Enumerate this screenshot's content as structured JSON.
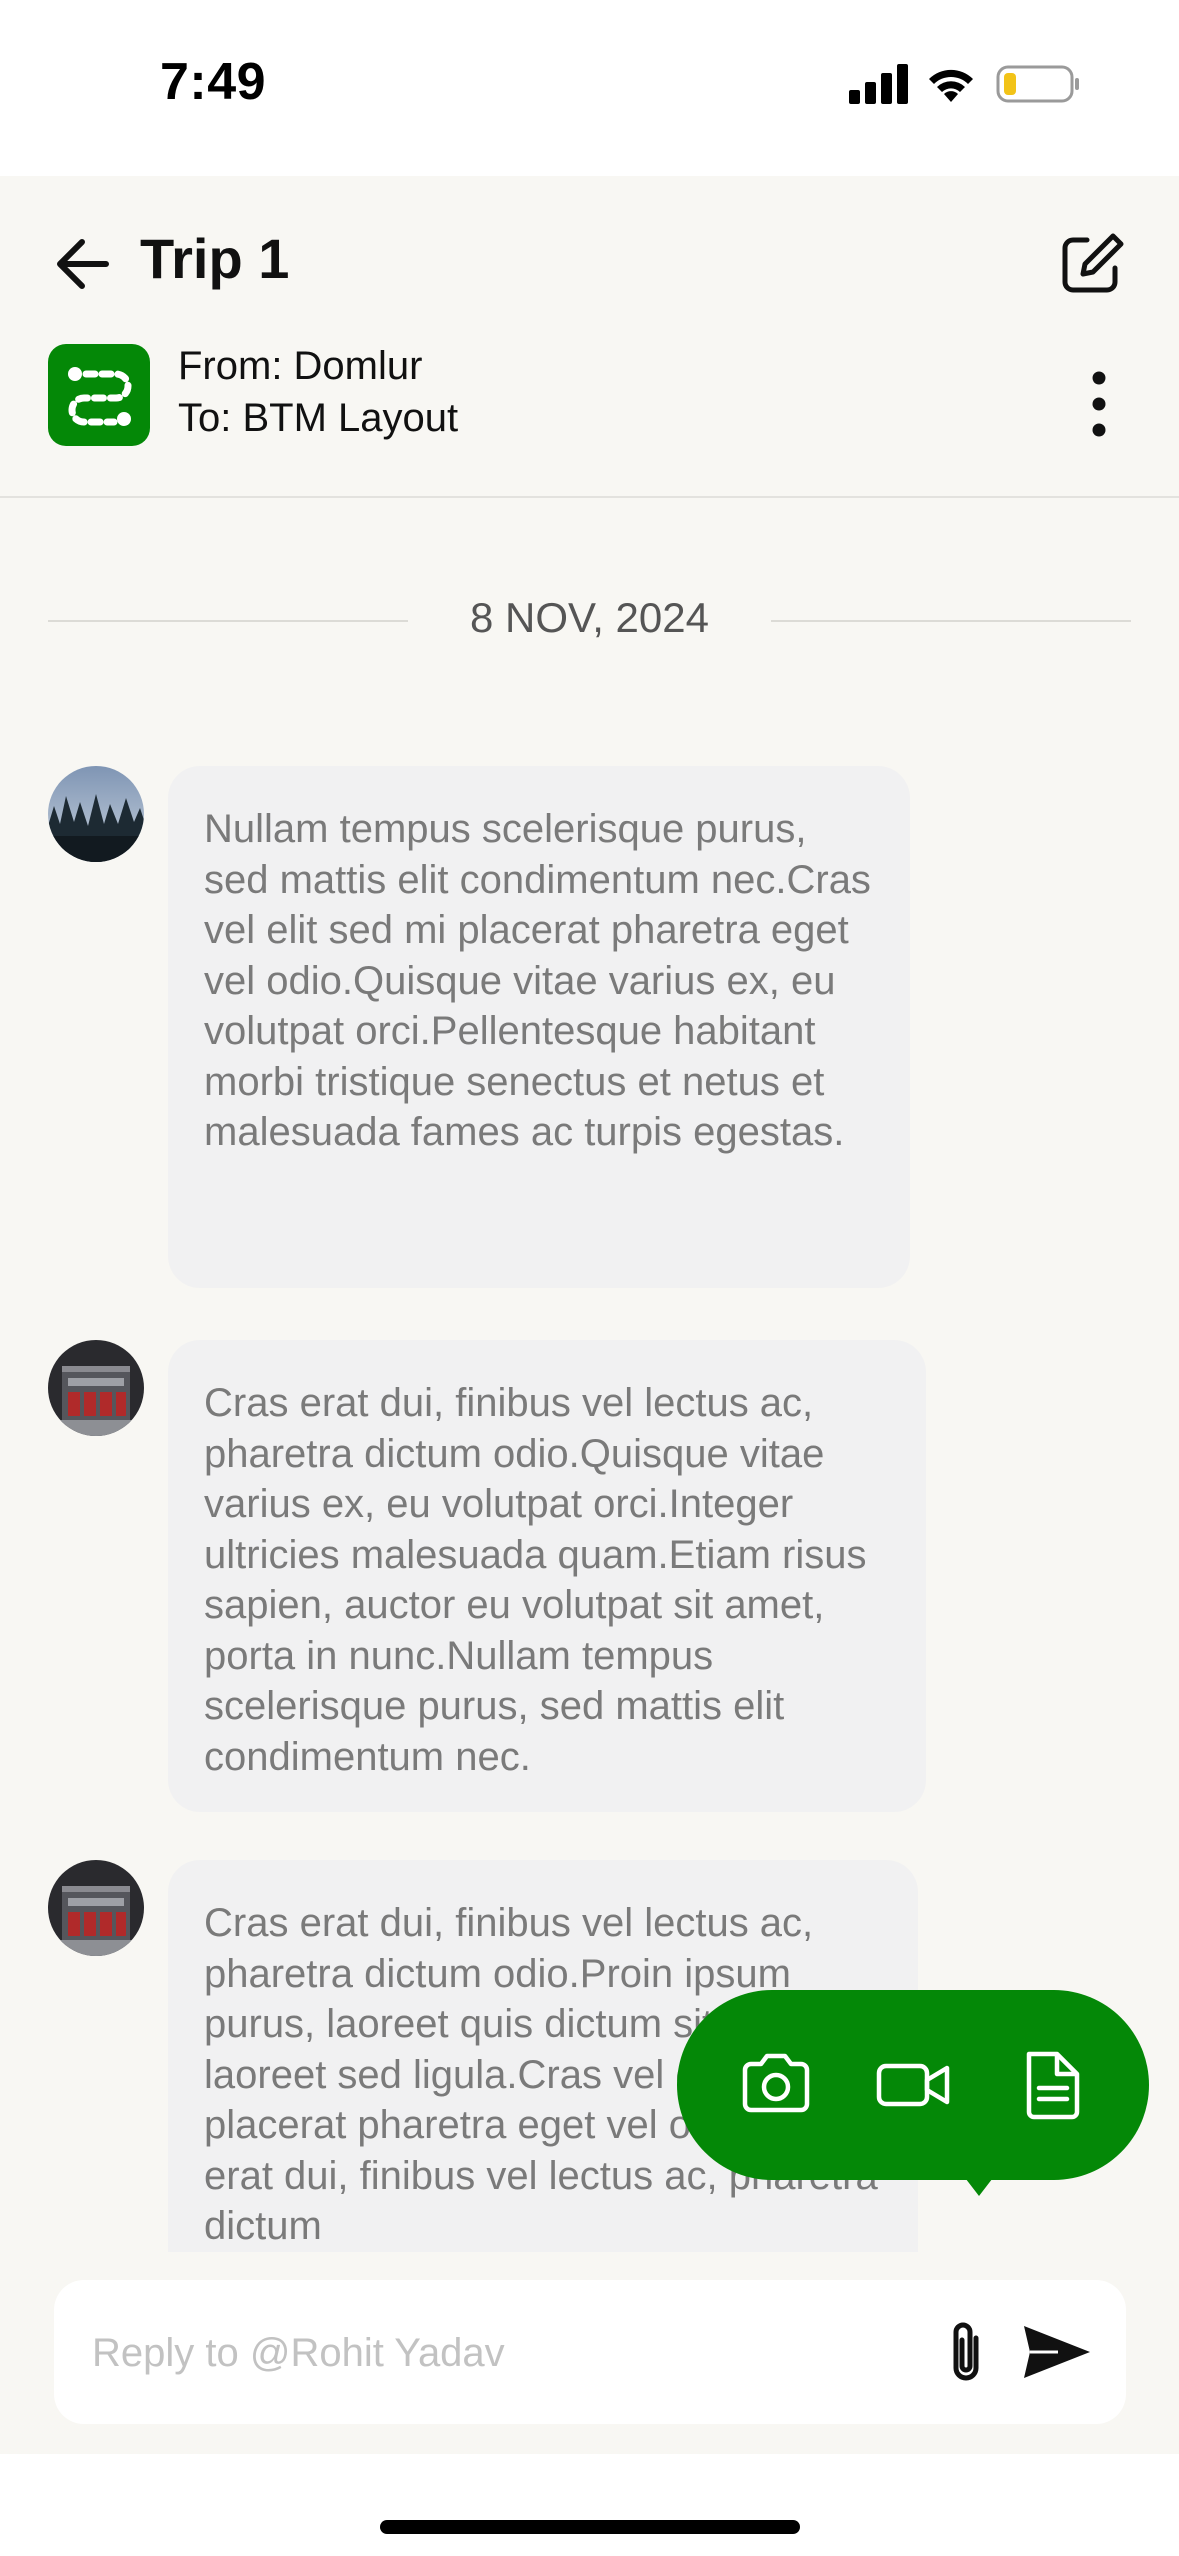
{
  "status_bar": {
    "time": "7:49",
    "icons": [
      "cellular-signal-icon",
      "wifi-icon",
      "battery-low-icon"
    ]
  },
  "header": {
    "title": "Trip 1",
    "route": {
      "from": "From: Domlur",
      "to": "To: BTM Layout"
    }
  },
  "chat": {
    "date": "8 NOV, 2024",
    "messages": [
      {
        "avatar": "forest-avatar",
        "text": "Nullam tempus scelerisque purus, sed mattis elit condimentum nec.Cras vel elit sed mi placerat pharetra eget vel odio.Quisque vitae varius ex, eu volutpat orci.Pellentesque habitant morbi tristique senectus et netus et malesuada fames ac turpis egestas."
      },
      {
        "avatar": "building-avatar",
        "text": "Cras erat dui, finibus vel lectus ac, pharetra dictum odio.Quisque vitae varius ex, eu volutpat orci.Integer ultricies malesuada quam.Etiam risus sapien, auctor eu volutpat sit amet, porta in nunc.Nullam tempus scelerisque purus, sed mattis elit condimentum nec."
      },
      {
        "avatar": "building-avatar",
        "text": "Cras erat dui, finibus vel lectus ac, pharetra dictum odio.Proin ipsum purus, laoreet quis dictum sit amet, laoreet sed ligula.Cras vel elit sed mi placerat pharetra eget vel odio.Cras erat dui, finibus vel lectus ac, pharetra dictum"
      }
    ]
  },
  "composer": {
    "placeholder": "Reply to @Rohit Yadav",
    "value": ""
  },
  "attach_menu": {
    "options": [
      "camera-icon",
      "video-camera-icon",
      "document-icon"
    ]
  },
  "colors": {
    "accent": "#048807",
    "background": "#f8f7f3",
    "bubble": "#f1f1f2",
    "bubble_text": "#7a7a7a"
  }
}
